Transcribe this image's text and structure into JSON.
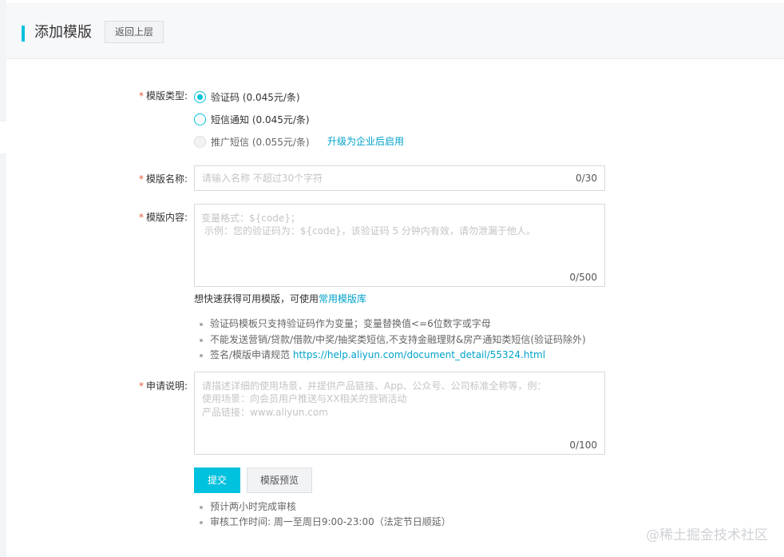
{
  "header": {
    "title": "添加模版",
    "back_label": "返回上层"
  },
  "form": {
    "type_label": "模版类型:",
    "type_options": [
      {
        "label": "验证码 (0.045元/条)",
        "state": "checked"
      },
      {
        "label": "短信通知 (0.045元/条)",
        "state": "unchecked"
      },
      {
        "label": "推广短信 (0.055元/条)",
        "state": "disabled"
      }
    ],
    "upgrade_link": "升级为企业后启用",
    "name_label": "模版名称:",
    "name_placeholder": "请输入名称 不超过30个字符",
    "name_counter": "0/30",
    "content_label": "模版内容:",
    "content_placeholder_line1": "变量格式：${code}；",
    "content_placeholder_line2": " 示例：您的验证码为：${code}，该验证码 5 分钟内有效，请勿泄漏于他人。",
    "content_counter": "0/500",
    "quick_tip_text": "想快速获得可用模版，可使用",
    "quick_tip_link": "常用模版库",
    "rules": [
      {
        "text": "验证码模板只支持验证码作为变量；变量替换值<=6位数字或字母"
      },
      {
        "text": "不能发送营销/贷款/借款/中奖/抽奖类短信,不支持金融理财&房产通知类短信(验证码除外)"
      },
      {
        "text": "签名/模版申请规范 ",
        "link": "https://help.aliyun.com/document_detail/55324.html"
      }
    ],
    "desc_label": "申请说明:",
    "desc_placeholder_line1": "请描述详细的使用场景，并提供产品链接、App、公众号、公司标准全称等，例：",
    "desc_placeholder_line2": "使用场景：向会员用户推送与XX相关的营销活动",
    "desc_placeholder_line3": "产品链接：www.aliyun.com",
    "desc_counter": "0/100",
    "submit_label": "提交",
    "preview_label": "模版预览",
    "notes": [
      "预计两小时完成审核",
      "审核工作时间: 周一至周日9:00-23:00（法定节日顺延）"
    ]
  },
  "watermark": "@稀土掘金技术社区",
  "colors": {
    "accent": "#00c1de",
    "link": "#00a2ca",
    "required_star": "#e4593b"
  }
}
